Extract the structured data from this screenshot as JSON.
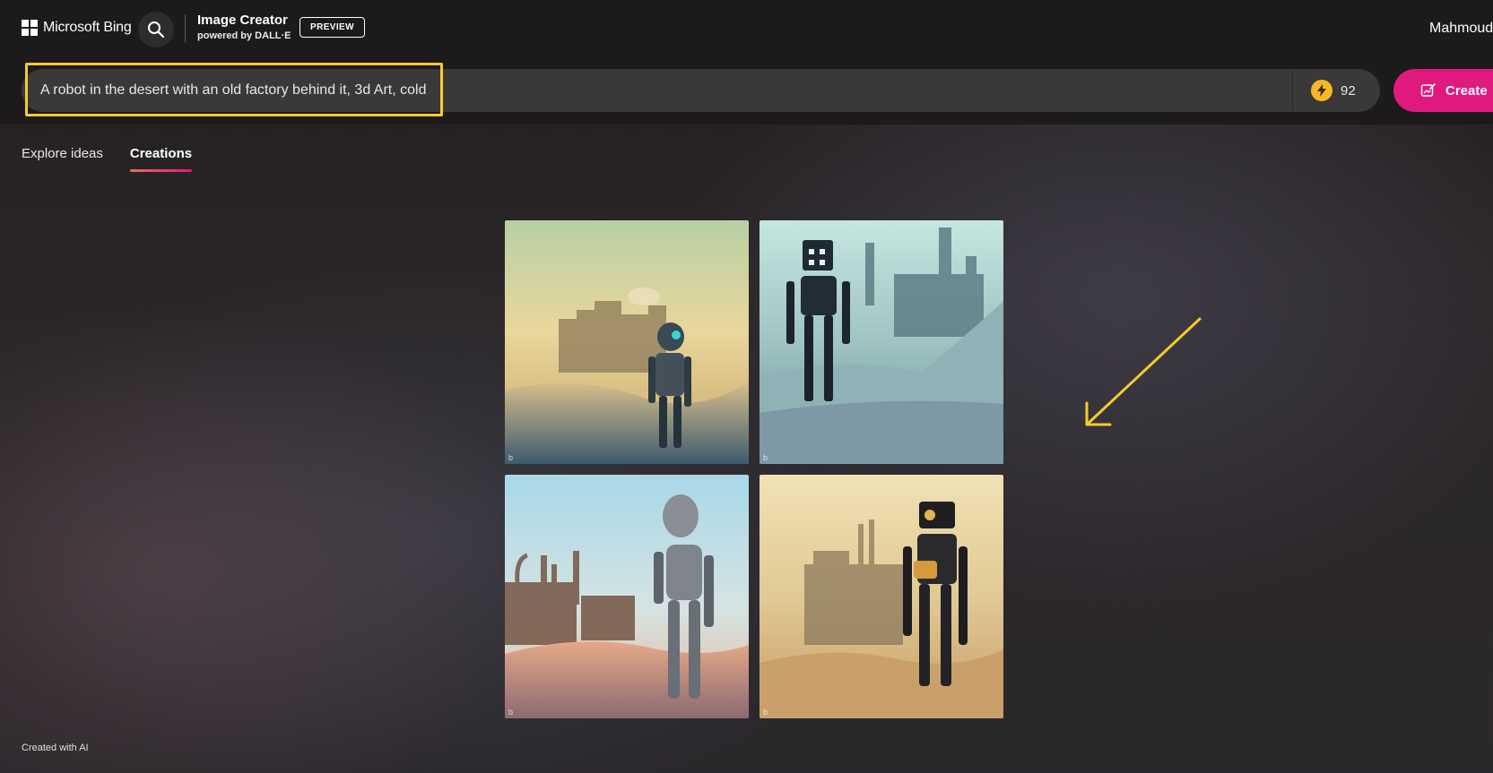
{
  "header": {
    "logo_text": "Microsoft Bing",
    "brand_title": "Image Creator",
    "brand_subtitle": "powered by DALL·E",
    "badge": "PREVIEW",
    "username": "Mahmoud"
  },
  "prompt": {
    "value": "A robot in the desert with an old factory behind it, 3d Art, cold",
    "boost_count": "92",
    "create_label": "Create"
  },
  "tabs": [
    {
      "label": "Explore ideas",
      "active": false
    },
    {
      "label": "Creations",
      "active": true
    }
  ],
  "images": [
    {
      "watermark": "b"
    },
    {
      "watermark": "b"
    },
    {
      "watermark": "b"
    },
    {
      "watermark": "b"
    }
  ],
  "footer": {
    "text": "Created with AI"
  },
  "colors": {
    "accent": "#e0197f",
    "highlight": "#f4cc2a",
    "boost": "#f6b827"
  }
}
